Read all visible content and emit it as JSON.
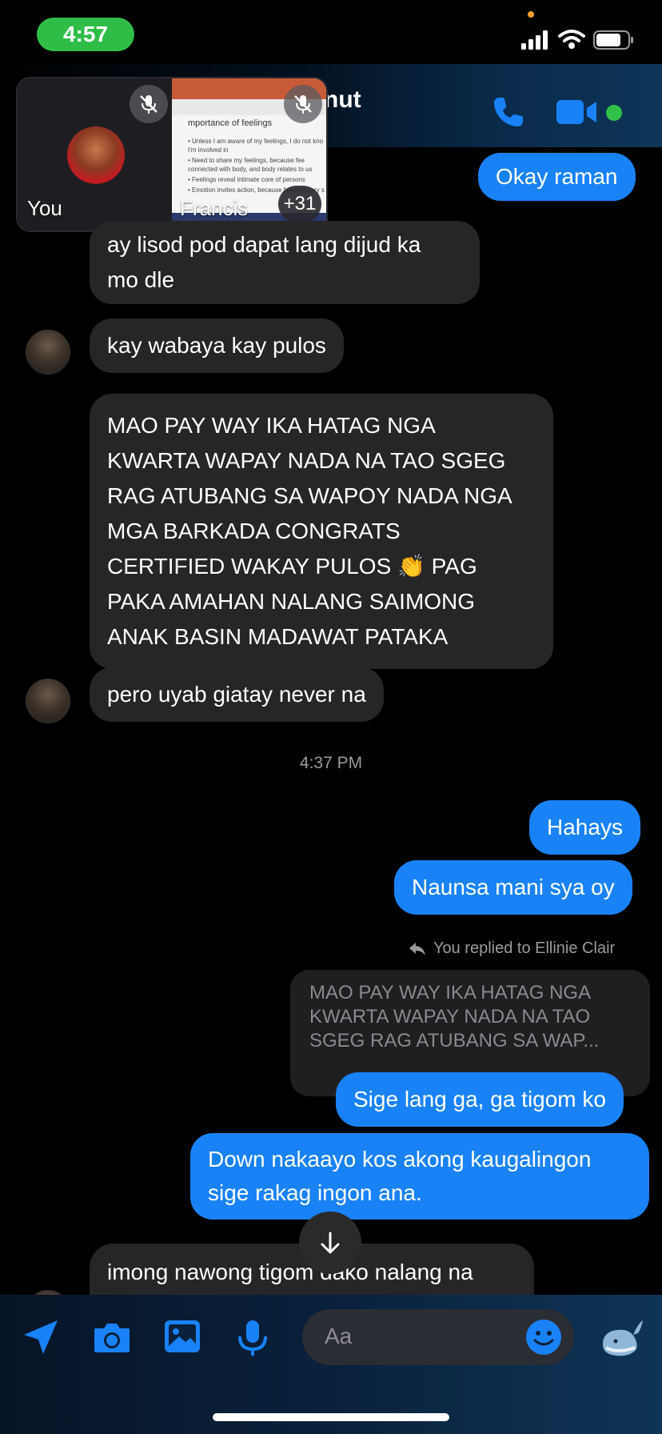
{
  "status_bar": {
    "time": "4:57"
  },
  "header": {
    "title_partial": "nut"
  },
  "call": {
    "you_label": "You",
    "other_label": "Francis",
    "extra_count": "+31",
    "slide": {
      "heading": "mportance of feelings",
      "bullets": [
        "• Unless I am aware of my feelings, I do not kno",
        "  I'm involved in",
        "• Need to share my feelings, because fee",
        "  connected with body, and body relates to us",
        "• Feelings reveal intimate core of persons",
        "• Emotion invites action, because feelings vary s"
      ]
    }
  },
  "messages": {
    "m1": "Okay raman",
    "m2_l1": "ay lisod pod dapat lang dijud ka",
    "m2_l2": "mo dle",
    "m3": "kay wabaya kay pulos",
    "m4_lines": [
      "MAO PAY WAY IKA HATAG NGA",
      "KWARTA WAPAY NADA NA TAO SGEG",
      "RAG ATUBANG SA WAPOY NADA NGA",
      "MGA BARKADA CONGRATS",
      "CERTIFIED WAKAY PULOS 👏 PAG",
      "PAKA AMAHAN NALANG SAIMONG",
      "ANAK BASIN MADAWAT PATAKA"
    ],
    "m5": "pero uyab giatay never na",
    "timestamp": "4:37 PM",
    "m6": "Hahays",
    "m7": "Naunsa mani sya oy",
    "replied_label": "You replied to Ellinie Clair",
    "quoted_lines": [
      "MAO PAY WAY IKA HATAG NGA",
      "KWARTA WAPAY NADA NA TAO",
      "SGEG RAG ATUBANG SA WAP..."
    ],
    "m8": "Sige lang ga, ga tigom ko",
    "m9_l1": "Down nakaayo kos akong kaugalingon",
    "m9_l2": "sige rakag ingon ana.",
    "m10": "imong nawong tigom dako nalang na"
  },
  "composer": {
    "placeholder": "Aa"
  },
  "colors": {
    "sent_bubble": "#1a82f7",
    "received_bubble": "#262629",
    "accent": "#1a82f7",
    "call_time_pill": "#2fbd48"
  },
  "icons": [
    "location-arrow-icon",
    "camera-icon",
    "image-icon",
    "microphone-icon",
    "emoji-icon",
    "whale-sticker-icon",
    "phone-icon",
    "video-camera-icon",
    "mic-muted-icon",
    "arrow-down-icon",
    "reply-arrow-icon"
  ]
}
